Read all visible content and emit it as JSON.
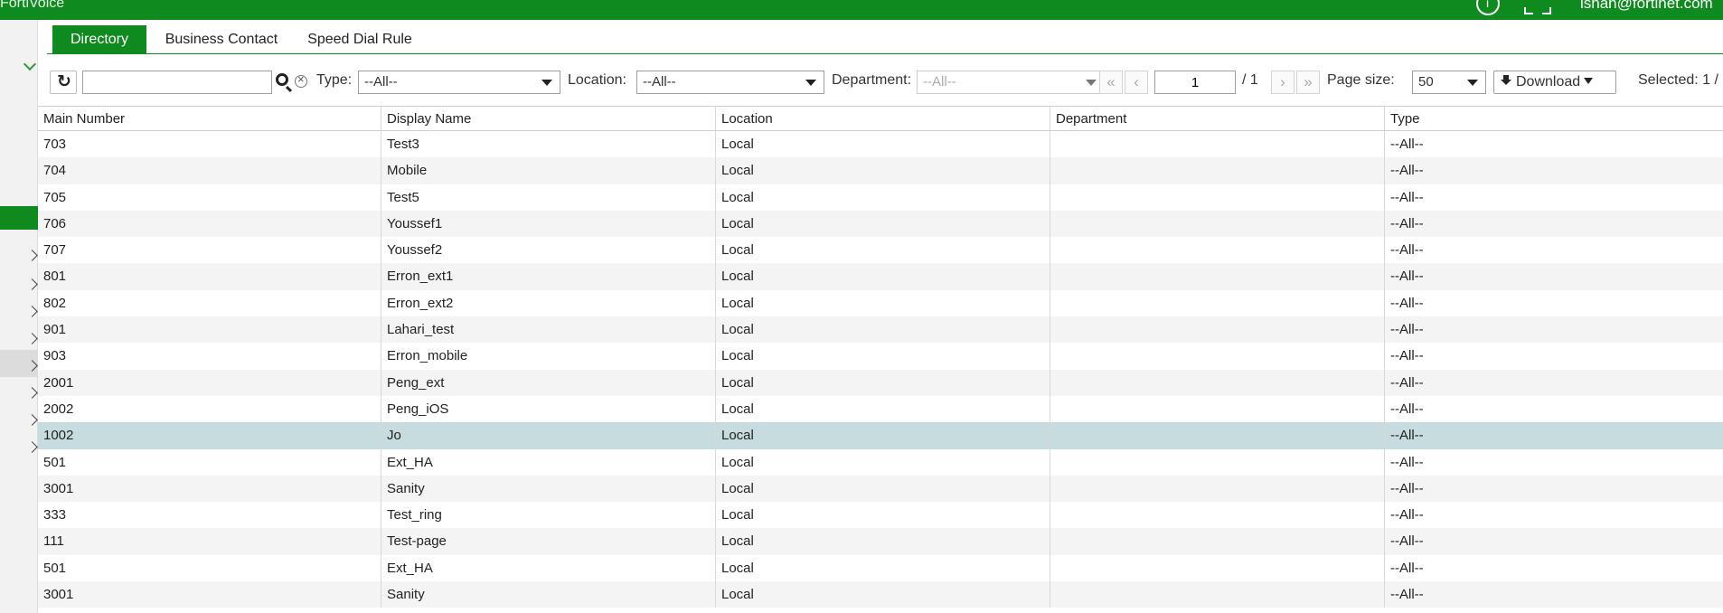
{
  "app": {
    "title": "FortiVoice",
    "user_email": "ishah@fortinet.com"
  },
  "tabs": [
    {
      "label": "Directory",
      "active": true
    },
    {
      "label": "Business Contact",
      "active": false
    },
    {
      "label": "Speed Dial Rule",
      "active": false
    }
  ],
  "toolbar": {
    "search_value": "",
    "type_label": "Type:",
    "type_value": "--All--",
    "location_label": "Location:",
    "location_value": "--All--",
    "department_label": "Department:",
    "department_value": "--All--",
    "first_label": "«",
    "prev_label": "‹",
    "page_value": "1",
    "page_total": "/ 1",
    "next_label": "›",
    "last_label": "»",
    "page_size_label": "Page size:",
    "page_size_value": "50",
    "download_label": "Download",
    "selected_label": "Selected: 1 /"
  },
  "table": {
    "columns": [
      "Main Number",
      "Display Name",
      "Location",
      "Department",
      "Type"
    ],
    "rows": [
      {
        "main": "703",
        "name": "Test3",
        "location": "Local",
        "department": "",
        "type": "--All--"
      },
      {
        "main": "704",
        "name": "Mobile",
        "location": "Local",
        "department": "",
        "type": "--All--"
      },
      {
        "main": "705",
        "name": "Test5",
        "location": "Local",
        "department": "",
        "type": "--All--"
      },
      {
        "main": "706",
        "name": "Youssef1",
        "location": "Local",
        "department": "",
        "type": "--All--"
      },
      {
        "main": "707",
        "name": "Youssef2",
        "location": "Local",
        "department": "",
        "type": "--All--"
      },
      {
        "main": "801",
        "name": "Erron_ext1",
        "location": "Local",
        "department": "",
        "type": "--All--"
      },
      {
        "main": "802",
        "name": "Erron_ext2",
        "location": "Local",
        "department": "",
        "type": "--All--"
      },
      {
        "main": "901",
        "name": "Lahari_test",
        "location": "Local",
        "department": "",
        "type": "--All--"
      },
      {
        "main": "903",
        "name": "Erron_mobile",
        "location": "Local",
        "department": "",
        "type": "--All--"
      },
      {
        "main": "2001",
        "name": "Peng_ext",
        "location": "Local",
        "department": "",
        "type": "--All--"
      },
      {
        "main": "2002",
        "name": "Peng_iOS",
        "location": "Local",
        "department": "",
        "type": "--All--"
      },
      {
        "main": "1002",
        "name": "Jo",
        "location": "Local",
        "department": "",
        "type": "--All--"
      },
      {
        "main": "501",
        "name": "Ext_HA",
        "location": "Local",
        "department": "",
        "type": "--All--"
      },
      {
        "main": "3001",
        "name": "Sanity",
        "location": "Local",
        "department": "",
        "type": "--All--"
      },
      {
        "main": "333",
        "name": "Test_ring",
        "location": "Local",
        "department": "",
        "type": "--All--"
      },
      {
        "main": "111",
        "name": "Test-page",
        "location": "Local",
        "department": "",
        "type": "--All--"
      },
      {
        "main": "501",
        "name": "Ext_HA",
        "location": "Local",
        "department": "",
        "type": "--All--"
      },
      {
        "main": "3001",
        "name": "Sanity",
        "location": "Local",
        "department": "",
        "type": "--All--"
      }
    ],
    "selected_index": 11
  }
}
